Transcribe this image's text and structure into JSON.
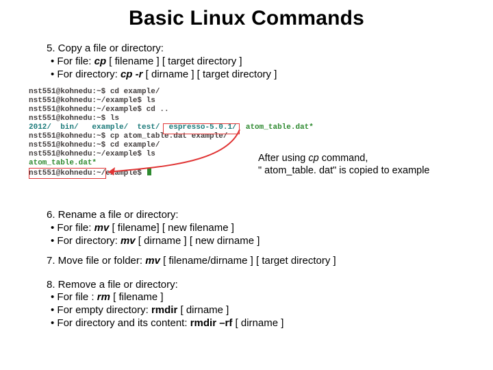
{
  "title": "Basic Linux Commands",
  "sec5": {
    "head": "5. Copy a file or directory:",
    "b1_pre": "For file: ",
    "b1_cmd": "cp",
    "b1_post": " [ filename ] [ target directory ]",
    "b2_pre": "For directory: ",
    "b2_cmd": "cp -r",
    "b2_post": " [ dirname ] [ target directory ]"
  },
  "term": {
    "l1": "nst551@kohnedu:~$ cd example/",
    "l2": "nst551@kohnedu:~/example$ ls",
    "l3": "nst551@kohnedu:~/example$ cd ..",
    "l4": "nst551@kohnedu:~$ ls",
    "l5a": "2012/  bin/   example/  test/  espresso-5.0.1/  ",
    "l5b": "atom_table.dat*",
    "l6": "nst551@kohnedu:~$ cp atom_table.dat example/",
    "l7": "nst551@kohnedu:~$ cd example/",
    "l8": "nst551@kohnedu:~/example$ ls",
    "l9": "atom_table.dat*",
    "l10": "nst551@kohnedu:~/example$ "
  },
  "annot": {
    "line1_a": "After using ",
    "line1_cmd": "cp",
    "line1_b": " command,",
    "line2": "\" atom_table. dat\" is copied to example"
  },
  "sec6": {
    "head": "6. Rename a file or directory:",
    "b1_pre": "For file: ",
    "b1_cmd": "mv",
    "b1_post": " [ filename]  [ new filename ]",
    "b2_pre": "For directory: ",
    "b2_cmd": "mv",
    "b2_post": " [ dirname ] [ new dirname ]"
  },
  "sec7": {
    "pre": "7. Move file or folder: ",
    "cmd": "mv",
    "post": " [ filename/dirname ] [ target directory ]"
  },
  "sec8": {
    "head": "8. Remove a file or directory:",
    "b1_pre": "For file : ",
    "b1_cmd": "rm",
    "b1_post": " [ filename ]",
    "b2_pre": "For empty directory: ",
    "b2_cmd": "rmdir",
    "b2_post": " [ dirname ]",
    "b3_pre": "For directory and its content: ",
    "b3_cmd": "rmdir –rf",
    "b3_post": " [ dirname ]"
  }
}
